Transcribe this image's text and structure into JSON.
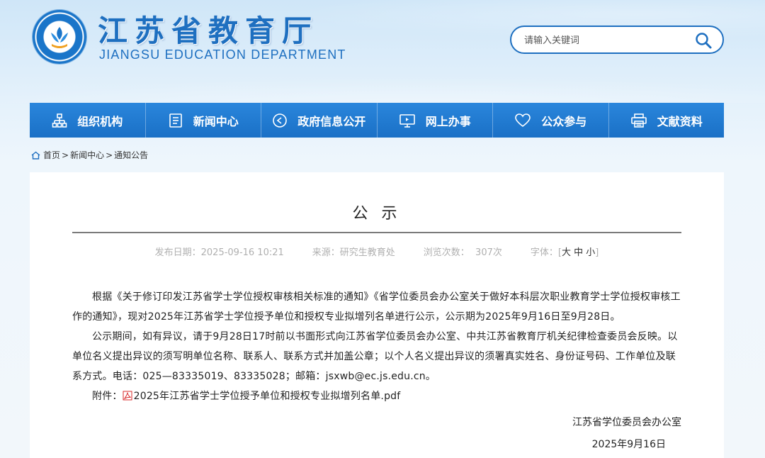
{
  "header": {
    "title": "江苏省教育厅",
    "subtitle": "JIANGSU EDUCATION DEPARTMENT",
    "search_placeholder": "请输入关键词"
  },
  "nav": {
    "items": [
      {
        "label": "组织机构",
        "icon": "org-chart-icon"
      },
      {
        "label": "新闻中心",
        "icon": "document-icon"
      },
      {
        "label": "政府信息公开",
        "icon": "target-icon"
      },
      {
        "label": "网上办事",
        "icon": "monitor-icon"
      },
      {
        "label": "公众参与",
        "icon": "heart-icon"
      },
      {
        "label": "文献资料",
        "icon": "printer-icon"
      }
    ]
  },
  "breadcrumb": {
    "home": "首页",
    "level1": "新闻中心",
    "level2": "通知公告"
  },
  "article": {
    "title": "公 示",
    "publish_date": "发布日期：2025-09-16 10:21",
    "source": "来源：研究生教育处",
    "views": "浏览次数：  307次",
    "font_size_label": "字体：",
    "font_large": "大",
    "font_medium": "中",
    "font_small": "小",
    "paragraph1": "根据《关于修订印发江苏省学士学位授权审核相关标准的通知》《省学位委员会办公室关于做好本科层次职业教育学士学位授权审核工作的通知》，现对2025年江苏省学士学位授予单位和授权专业拟增列名单进行公示，公示期为2025年9月16日至9月28日。",
    "paragraph2": "公示期间，如有异议，请于9月28日17时前以书面形式向江苏省学位委员会办公室、中共江苏省教育厅机关纪律检查委员会反映。以单位名义提出异议的须写明单位名称、联系人、联系方式并加盖公章；以个人名义提出异议的须署真实姓名、身份证号码、工作单位及联系方式。电话：025—83335019、83335028；邮箱：jsxwb@ec.js.edu.cn。",
    "attachment_label": "附件：",
    "attachment_name": "2025年江苏省学士学位授予单位和授权专业拟增列名单.pdf",
    "signature_org": "江苏省学位委员会办公室",
    "signature_date": "2025年9月16日"
  },
  "colors": {
    "brand_blue": "#1e6fc0",
    "nav_blue": "#2a86dc",
    "pdf_red": "#d8282a"
  }
}
